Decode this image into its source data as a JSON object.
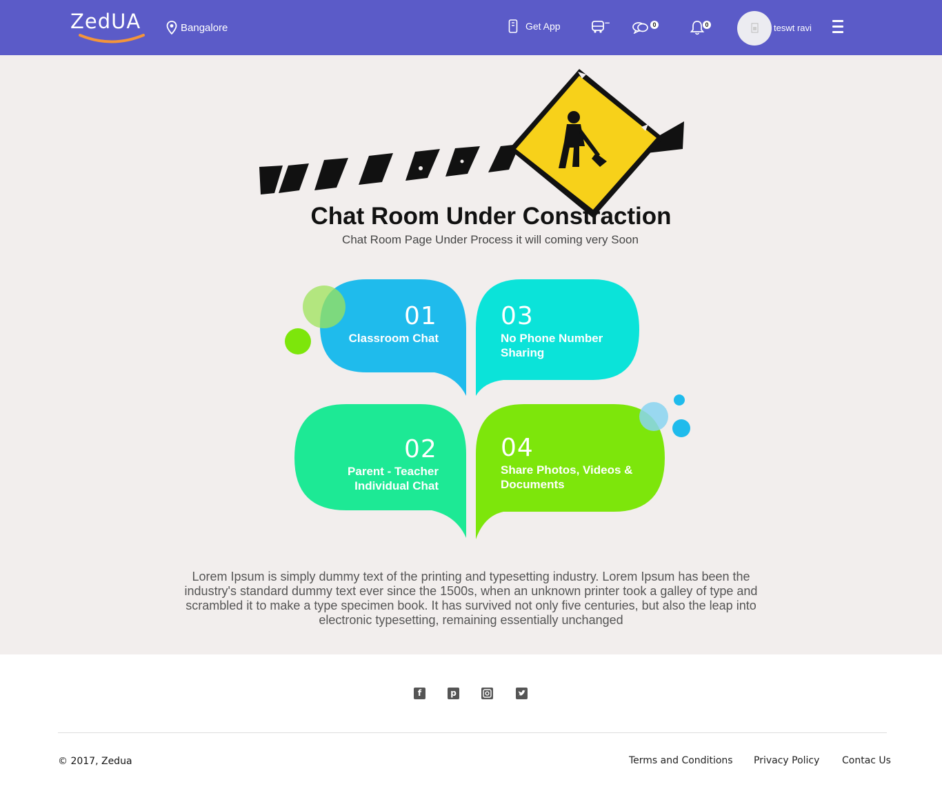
{
  "brand": {
    "logo_text": "ZedUA"
  },
  "header": {
    "location": "Bangalore",
    "get_app": "Get App",
    "bus_badge": "–",
    "chat_badge": "0",
    "notif_badge": "0",
    "username": "teswt ravi"
  },
  "main": {
    "title": "Chat Room Under Constraction",
    "subtitle": "Chat Room Page Under Process it will coming very Soon",
    "features": [
      {
        "num": "01",
        "label": "Classroom Chat"
      },
      {
        "num": "02",
        "label_line1": "Parent - Teacher",
        "label_line2": "Individual Chat"
      },
      {
        "num": "03",
        "label_line1": "No Phone Number",
        "label_line2": "Sharing"
      },
      {
        "num": "04",
        "label_line1": "Share Photos, Videos &",
        "label_line2": "Documents"
      }
    ],
    "description": "Lorem Ipsum is simply dummy text of the printing and typesetting industry. Lorem Ipsum has been the industry's standard dummy text ever since the 1500s, when an unknown printer took a galley of type and scrambled it to make a type specimen book. It has survived not only five centuries, but also the leap into electronic typesetting, remaining essentially unchanged"
  },
  "footer": {
    "social": [
      "facebook-icon",
      "pinterest-icon",
      "instagram-icon",
      "twitter-icon"
    ],
    "copyright": "© 2017, Zedua",
    "links": [
      "Terms and Conditions",
      "Privacy Policy",
      "Contac Us"
    ]
  },
  "colors": {
    "header_bg": "#5b5bc8",
    "page_bg": "#f2eeed",
    "bubble1": "#1fbbec",
    "bubble2": "#1de995",
    "bubble3": "#0be3d9",
    "bubble4": "#7de60b",
    "sign_yellow": "#f7d11a"
  }
}
